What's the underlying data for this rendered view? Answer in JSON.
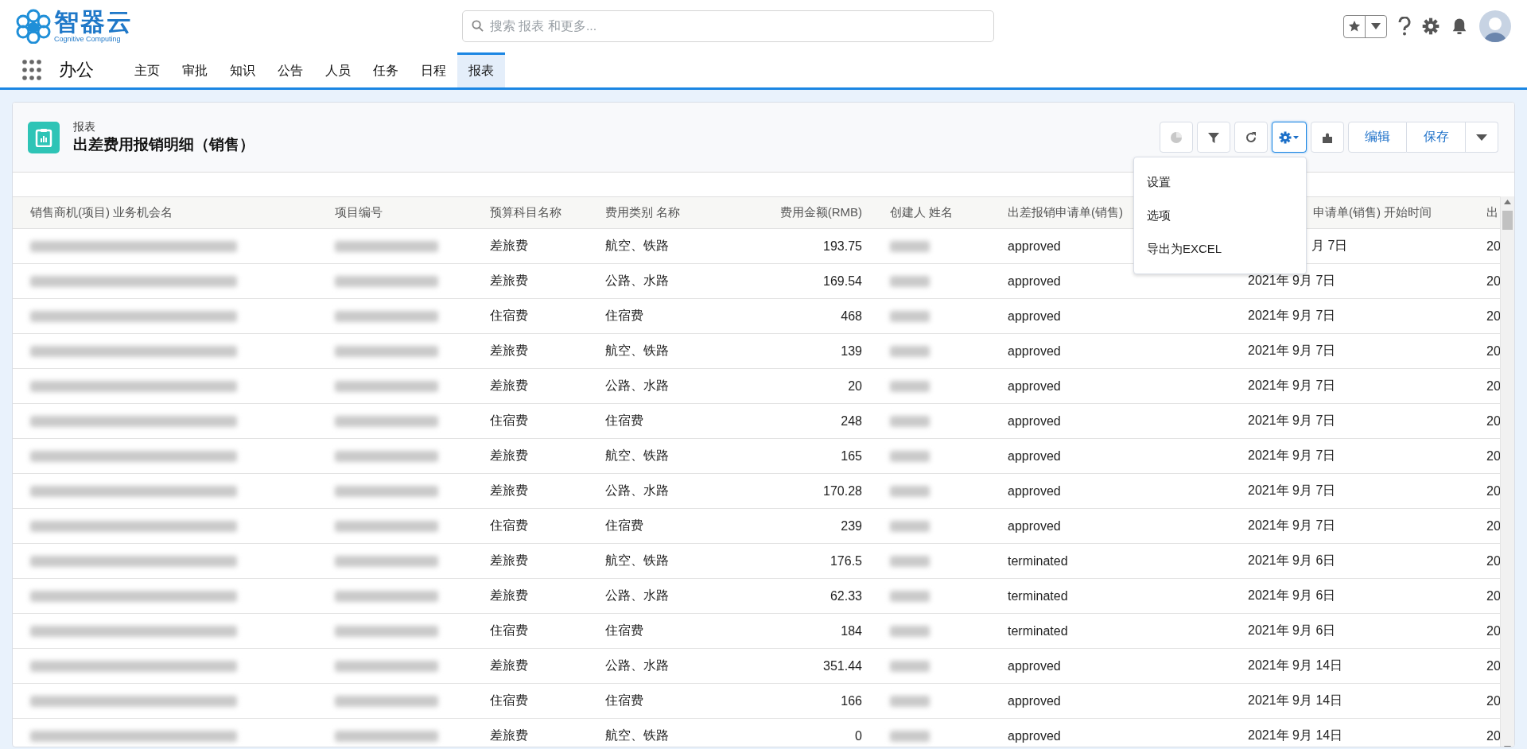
{
  "header": {
    "logo": {
      "name": "智器云",
      "tagline": "Cognitive Computing"
    },
    "search": {
      "placeholder": "搜索 报表 和更多..."
    }
  },
  "nav": {
    "app": "办公",
    "tabs": [
      {
        "label": "主页",
        "selected": false
      },
      {
        "label": "审批",
        "selected": false
      },
      {
        "label": "知识",
        "selected": false
      },
      {
        "label": "公告",
        "selected": false
      },
      {
        "label": "人员",
        "selected": false
      },
      {
        "label": "任务",
        "selected": false
      },
      {
        "label": "日程",
        "selected": false
      },
      {
        "label": "报表",
        "selected": true
      }
    ]
  },
  "report": {
    "type": "报表",
    "title": "出差费用报销明细（销售）",
    "toolbar": [
      {
        "kind": "chart",
        "disabled": true,
        "expanded": false
      },
      {
        "kind": "filter",
        "disabled": false,
        "expanded": false
      },
      {
        "kind": "refresh",
        "disabled": false,
        "expanded": false
      },
      {
        "kind": "gear",
        "disabled": false,
        "expanded": true
      },
      {
        "kind": "puzzle",
        "disabled": false,
        "expanded": false
      }
    ],
    "actions": [
      "编辑",
      "保存"
    ],
    "menu": {
      "items": [
        "设置",
        "选项",
        "导出为EXCEL"
      ]
    }
  },
  "table": {
    "columns": [
      {
        "label": "销售商机(项目) 业务机会名",
        "kind": "blurred"
      },
      {
        "label": "项目编号",
        "kind": "blurred"
      },
      {
        "label": "预算科目名称",
        "kind": "text"
      },
      {
        "label": "费用类别 名称",
        "kind": "text"
      },
      {
        "label": "费用金额(RMB)",
        "kind": "number"
      },
      {
        "label": "创建人 姓名",
        "kind": "blurred"
      },
      {
        "label": "出差报销申请单(销售)",
        "kind": "text"
      },
      {
        "label": "申请单(销售) 开始时间",
        "kind": "text"
      },
      {
        "label": "出",
        "kind": "text"
      }
    ],
    "rows": [
      [
        "",
        "",
        "差旅费",
        "航空、铁路",
        "193.75",
        "",
        "approved",
        "月 7日",
        "20"
      ],
      [
        "",
        "",
        "差旅费",
        "公路、水路",
        "169.54",
        "",
        "approved",
        "2021年 9月 7日",
        "20"
      ],
      [
        "",
        "",
        "住宿费",
        "住宿费",
        "468",
        "",
        "approved",
        "2021年 9月 7日",
        "20"
      ],
      [
        "",
        "",
        "差旅费",
        "航空、铁路",
        "139",
        "",
        "approved",
        "2021年 9月 7日",
        "20"
      ],
      [
        "",
        "",
        "差旅费",
        "公路、水路",
        "20",
        "",
        "approved",
        "2021年 9月 7日",
        "20"
      ],
      [
        "",
        "",
        "住宿费",
        "住宿费",
        "248",
        "",
        "approved",
        "2021年 9月 7日",
        "20"
      ],
      [
        "",
        "",
        "差旅费",
        "航空、铁路",
        "165",
        "",
        "approved",
        "2021年 9月 7日",
        "20"
      ],
      [
        "",
        "",
        "差旅费",
        "公路、水路",
        "170.28",
        "",
        "approved",
        "2021年 9月 7日",
        "20"
      ],
      [
        "",
        "",
        "住宿费",
        "住宿费",
        "239",
        "",
        "approved",
        "2021年 9月 7日",
        "20"
      ],
      [
        "",
        "",
        "差旅费",
        "航空、铁路",
        "176.5",
        "",
        "terminated",
        "2021年 9月 6日",
        "20"
      ],
      [
        "",
        "",
        "差旅费",
        "公路、水路",
        "62.33",
        "",
        "terminated",
        "2021年 9月 6日",
        "20"
      ],
      [
        "",
        "",
        "住宿费",
        "住宿费",
        "184",
        "",
        "terminated",
        "2021年 9月 6日",
        "20"
      ],
      [
        "",
        "",
        "差旅费",
        "公路、水路",
        "351.44",
        "",
        "approved",
        "2021年 9月 14日",
        "20"
      ],
      [
        "",
        "",
        "住宿费",
        "住宿费",
        "166",
        "",
        "approved",
        "2021年 9月 14日",
        "20"
      ],
      [
        "",
        "",
        "差旅费",
        "航空、铁路",
        "0",
        "",
        "approved",
        "2021年 9月 14日",
        "20"
      ]
    ]
  }
}
